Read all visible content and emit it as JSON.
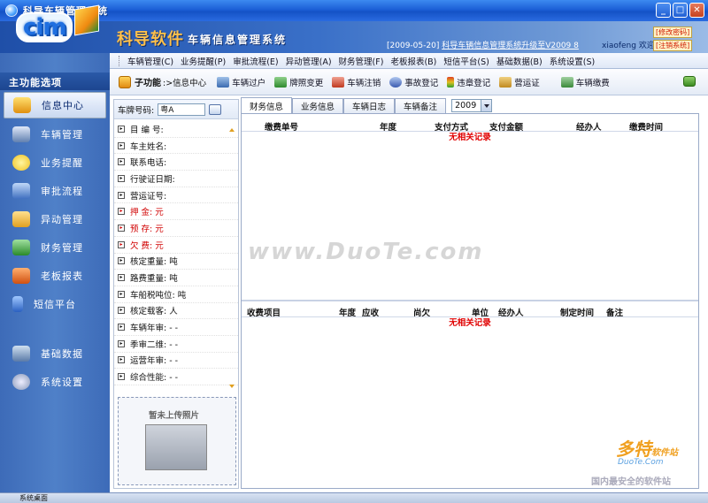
{
  "window": {
    "title": "科导车辆管理系统"
  },
  "header": {
    "logo_text": "cim",
    "brand": "科导软件",
    "system_name": "车辆信息管理系统",
    "ticker_date": "[2009-05-20]",
    "ticker_news": "科导车辆信息管理系统升级至V2009 8",
    "welcome": "xiaofeng 欢迎您!",
    "link1": "[修改密码]",
    "link2": "[注销系统]"
  },
  "menu": {
    "items": [
      "车辆管理(C)",
      "业务提醒(P)",
      "审批流程(E)",
      "异动管理(A)",
      "财务管理(F)",
      "老板报表(B)",
      "短信平台(S)",
      "基础数据(B)",
      "系统设置(S)"
    ]
  },
  "subbar": {
    "label": "子功能",
    "crumb": ":>信息中心",
    "tools": [
      "车辆过户",
      "牌照变更",
      "车辆注销",
      "事故登记",
      "违章登记",
      "营运证",
      "车辆缴费"
    ]
  },
  "nav": {
    "header": "主功能选项",
    "items": [
      "信息中心",
      "车辆管理",
      "业务提醒",
      "审批流程",
      "异动管理",
      "财务管理",
      "老板报表",
      "短信平台"
    ],
    "items2": [
      "基础数据",
      "系统设置"
    ]
  },
  "info": {
    "plate_label": "车牌号码:",
    "plate_value": "粤A",
    "fields": [
      "目 编 号:",
      "车主姓名:",
      "联系电话:",
      "行驶证日期:",
      "营运证号:",
      "押    金: 元",
      "预    存: 元",
      "欠    费: 元",
      "核定重量:  吨",
      "路费重量:  吨",
      "车船税吨位:  吨",
      "核定载客:  人",
      "车辆年审: - -",
      "季审二维: - -",
      "运营年审: - -",
      "综合性能: - -"
    ],
    "photo_label": "暂未上传照片"
  },
  "tabs": {
    "items": [
      "财务信息",
      "业务信息",
      "车辆日志",
      "车辆备注"
    ],
    "year": "2009"
  },
  "grid1": {
    "columns": [
      "缴费单号",
      "年度",
      "支付方式",
      "支付金额",
      "经办人",
      "缴费时间"
    ],
    "empty": "无相关记录"
  },
  "grid2": {
    "columns": [
      "收费项目",
      "年度",
      "应收",
      "尚欠",
      "单位",
      "经办人",
      "制定时间",
      "备注"
    ],
    "empty": "无相关记录"
  },
  "status": {
    "text": "系统桌面"
  },
  "watermark": {
    "main": "www.DuoTe.com",
    "brand": "多特",
    "brand_small": "软件站",
    "site": "DuoTe.Com",
    "slogan": "国内最安全的软件站"
  }
}
